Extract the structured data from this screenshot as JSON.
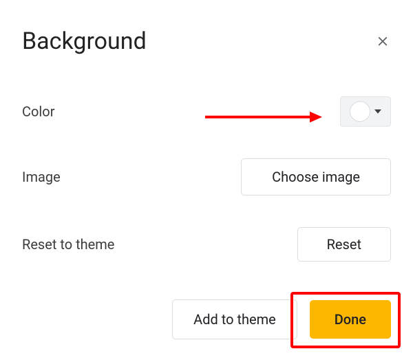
{
  "dialog": {
    "title": "Background",
    "rows": {
      "color": {
        "label": "Color",
        "selected_color": "#ffffff"
      },
      "image": {
        "label": "Image",
        "button": "Choose image"
      },
      "reset": {
        "label": "Reset to theme",
        "button": "Reset"
      }
    },
    "footer": {
      "add_to_theme": "Add to theme",
      "done": "Done"
    }
  },
  "annotations": {
    "arrow_target": "color-picker",
    "highlight_target": "done-button",
    "color": "#ff0000"
  }
}
